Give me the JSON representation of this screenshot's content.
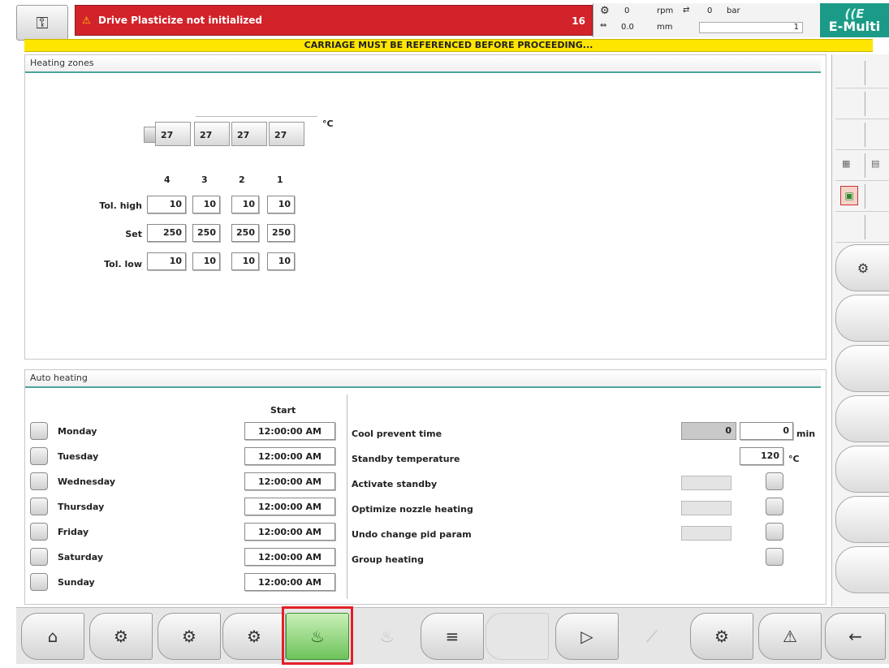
{
  "topbar": {
    "alarm_text": "Drive Plasticize not initialized",
    "alarm_count": "16",
    "status": {
      "rpm_value": "0",
      "rpm_unit": "rpm",
      "pressure_value": "0",
      "pressure_unit": "bar",
      "mm_value": "0.0",
      "mm_unit": "mm",
      "field_value": "1"
    },
    "logo_text": "E-Multi",
    "notice": "CARRIAGE MUST BE REFERENCED BEFORE PROCEEDING..."
  },
  "heating": {
    "title": "Heating zones",
    "unit": "°C",
    "actual": [
      "27",
      "27",
      "27",
      "27"
    ],
    "zone_numbers": [
      "4",
      "3",
      "2",
      "1"
    ],
    "tol_high_label": "Tol. high",
    "set_label": "Set",
    "tol_low_label": "Tol. low",
    "tol_high": [
      "10",
      "10",
      "10",
      "10"
    ],
    "set": [
      "250",
      "250",
      "250",
      "250"
    ],
    "tol_low": [
      "10",
      "10",
      "10",
      "10"
    ]
  },
  "auto": {
    "title": "Auto heating",
    "start_header": "Start",
    "days": [
      {
        "label": "Monday",
        "time": "12:00:00 AM"
      },
      {
        "label": "Tuesday",
        "time": "12:00:00 AM"
      },
      {
        "label": "Wednesday",
        "time": "12:00:00 AM"
      },
      {
        "label": "Thursday",
        "time": "12:00:00 AM"
      },
      {
        "label": "Friday",
        "time": "12:00:00 AM"
      },
      {
        "label": "Saturday",
        "time": "12:00:00 AM"
      },
      {
        "label": "Sunday",
        "time": "12:00:00 AM"
      }
    ],
    "cool_prevent_label": "Cool prevent time",
    "cool_prevent_actual": "0",
    "cool_prevent_value": "0",
    "cool_prevent_unit": "min",
    "standby_temp_label": "Standby temperature",
    "standby_temp_value": "120",
    "standby_temp_unit": "°C",
    "activate_standby_label": "Activate standby",
    "optimize_nozzle_label": "Optimize nozzle heating",
    "undo_pid_label": "Undo change pid param",
    "group_heating_label": "Group heating"
  },
  "icons": {
    "user": "user-key-icon",
    "home": "home-icon",
    "active_nav": "heating-icon",
    "back": "back-arrow-icon"
  }
}
